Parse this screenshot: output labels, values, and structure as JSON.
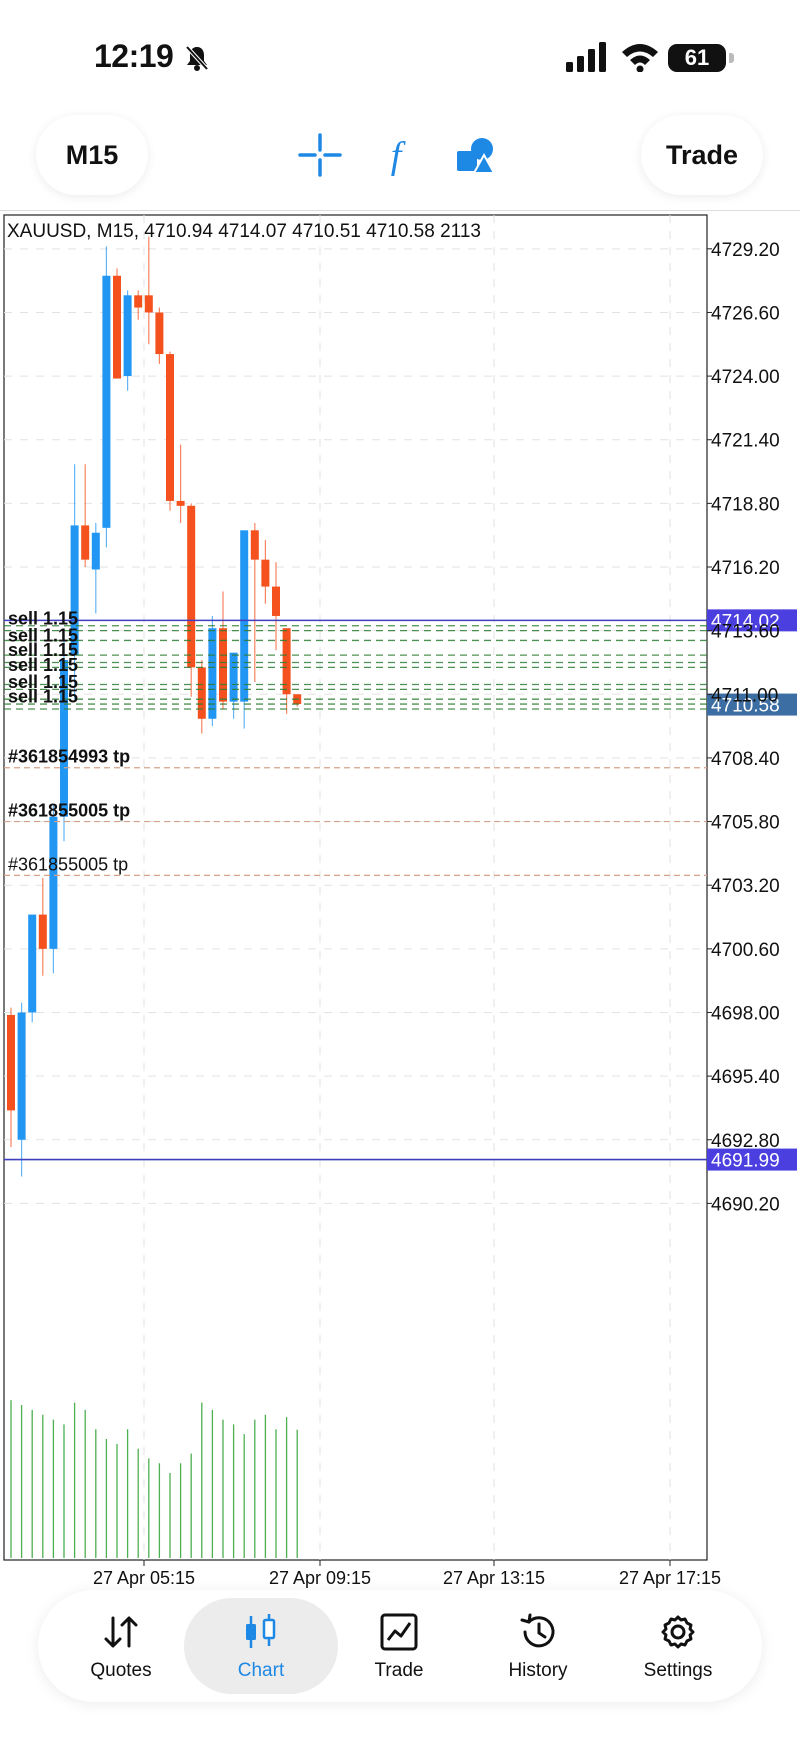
{
  "status_bar": {
    "time": "12:19",
    "battery": "61"
  },
  "toolbar": {
    "timeframe": "M15",
    "trade": "Trade"
  },
  "chart": {
    "header": "XAUUSD, M15, 4710.94 4714.07 4710.51 4710.58 2113",
    "price_ticks": [
      "4729.20",
      "4726.60",
      "4724.00",
      "4721.40",
      "4718.80",
      "4716.20",
      "4713.60",
      "4711.00",
      "4708.40",
      "4705.80",
      "4703.20",
      "4700.60",
      "4698.00",
      "4695.40",
      "4692.80",
      "4690.20"
    ],
    "time_ticks": [
      "27 Apr 05:15",
      "27 Apr 09:15",
      "27 Apr 13:15",
      "27 Apr 17:15"
    ],
    "bid_label": "4710.58",
    "upper_line_label": "4714.02",
    "lower_line_label": "4691.99",
    "order_labels": [
      "sell 1.15",
      "sell 1.15",
      "sell 1.15",
      "sell 1.15",
      "sell 1.15",
      "sell 1.15"
    ],
    "tp_labels": [
      "#361854993 tp",
      "#361855005 tp",
      "#361855005 tp"
    ],
    "colors": {
      "bull": "#2196f3",
      "bear": "#f4511e",
      "volume": "#4caf50",
      "line": "#3f3fbf",
      "bid": "#3d6ea3"
    }
  },
  "chart_data": {
    "type": "candlestick",
    "symbol": "XAUUSD",
    "timeframe": "M15",
    "ylim": [
      4688.5,
      4730.5
    ],
    "candles": [
      {
        "o": 4697.9,
        "h": 4698.2,
        "l": 4692.5,
        "c": 4694.0
      },
      {
        "o": 4692.8,
        "h": 4698.4,
        "l": 4691.3,
        "c": 4698.0
      },
      {
        "o": 4698.0,
        "h": 4701.6,
        "l": 4697.6,
        "c": 4702.0
      },
      {
        "o": 4702.0,
        "h": 4703.5,
        "l": 4699.5,
        "c": 4700.6
      },
      {
        "o": 4700.6,
        "h": 4706.5,
        "l": 4699.6,
        "c": 4706.0
      },
      {
        "o": 4706.0,
        "h": 4713.4,
        "l": 4705.0,
        "c": 4712.4
      },
      {
        "o": 4712.6,
        "h": 4720.4,
        "l": 4710.8,
        "c": 4717.9
      },
      {
        "o": 4717.9,
        "h": 4720.4,
        "l": 4716.2,
        "c": 4716.5
      },
      {
        "o": 4716.1,
        "h": 4718.0,
        "l": 4714.3,
        "c": 4717.6
      },
      {
        "o": 4717.8,
        "h": 4729.3,
        "l": 4717.0,
        "c": 4728.1
      },
      {
        "o": 4728.1,
        "h": 4728.4,
        "l": 4724.6,
        "c": 4723.9
      },
      {
        "o": 4724.0,
        "h": 4727.5,
        "l": 4723.4,
        "c": 4727.3
      },
      {
        "o": 4727.3,
        "h": 4727.5,
        "l": 4726.3,
        "c": 4726.8
      },
      {
        "o": 4727.3,
        "h": 4729.7,
        "l": 4725.3,
        "c": 4726.6
      },
      {
        "o": 4726.6,
        "h": 4726.8,
        "l": 4724.5,
        "c": 4724.9
      },
      {
        "o": 4724.9,
        "h": 4725.0,
        "l": 4718.5,
        "c": 4718.9
      },
      {
        "o": 4718.9,
        "h": 4721.2,
        "l": 4718.0,
        "c": 4718.7
      },
      {
        "o": 4718.7,
        "h": 4718.8,
        "l": 4710.9,
        "c": 4712.1
      },
      {
        "o": 4712.1,
        "h": 4712.4,
        "l": 4709.4,
        "c": 4710.0
      },
      {
        "o": 4710.0,
        "h": 4714.2,
        "l": 4709.7,
        "c": 4713.7
      },
      {
        "o": 4713.7,
        "h": 4715.2,
        "l": 4710.4,
        "c": 4710.7
      },
      {
        "o": 4710.7,
        "h": 4712.2,
        "l": 4710.0,
        "c": 4712.7
      },
      {
        "o": 4710.7,
        "h": 4716.3,
        "l": 4709.6,
        "c": 4717.7
      },
      {
        "o": 4717.7,
        "h": 4718.0,
        "l": 4711.5,
        "c": 4716.5
      },
      {
        "o": 4716.5,
        "h": 4717.3,
        "l": 4714.7,
        "c": 4715.4
      },
      {
        "o": 4715.4,
        "h": 4716.4,
        "l": 4712.8,
        "c": 4714.2
      },
      {
        "o": 4713.7,
        "h": 4713.6,
        "l": 4710.2,
        "c": 4711.0
      },
      {
        "o": 4711.0,
        "h": 4710.9,
        "l": 4710.5,
        "c": 4710.6
      }
    ],
    "volumes": [
      2600,
      2520,
      2440,
      2360,
      2280,
      2200,
      2560,
      2440,
      2120,
      1960,
      1880,
      2120,
      1800,
      1640,
      1560,
      1400,
      1560,
      1720,
      2560,
      2440,
      2280,
      2200,
      2040,
      2280,
      2360,
      2120,
      2320,
      2113
    ],
    "volume_max": 2800,
    "horizontal_lines": {
      "upper": 4714.02,
      "lower": 4691.99,
      "bid": 4710.58
    },
    "tp_levels": [
      4708.0,
      4705.8,
      4703.6
    ]
  }
}
